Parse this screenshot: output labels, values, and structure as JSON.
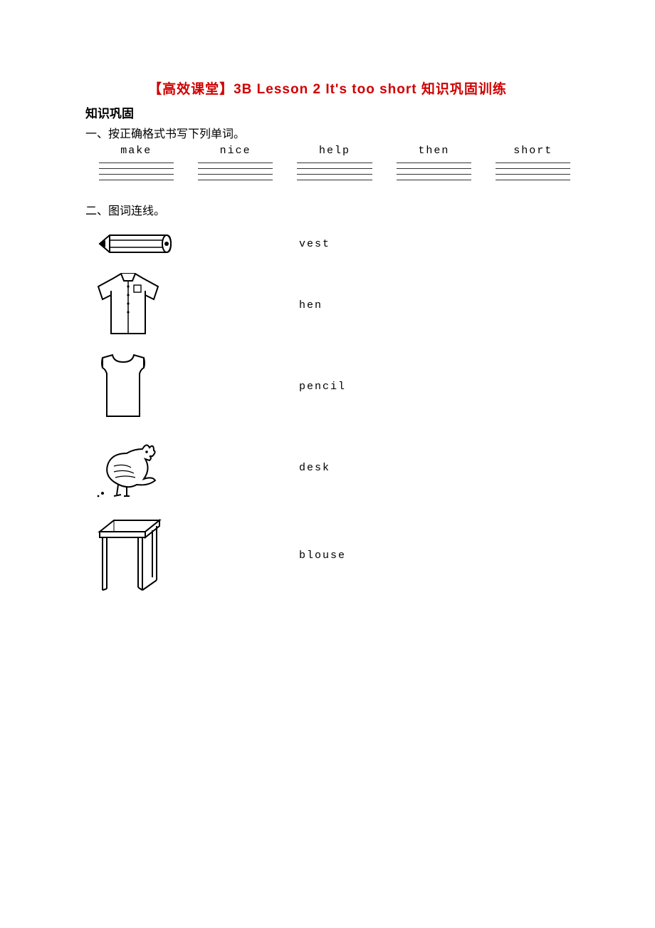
{
  "title": "【高效课堂】3B Lesson 2  It's too short 知识巩固训练",
  "subtitle": "知识巩固",
  "section1": {
    "instruction": "一、按正确格式书写下列单词。",
    "words": [
      "make",
      "nice",
      "help",
      "then",
      "short"
    ]
  },
  "section2": {
    "instruction": "二、图词连线。",
    "words": [
      "vest",
      "hen",
      "pencil",
      "desk",
      "blouse"
    ]
  }
}
